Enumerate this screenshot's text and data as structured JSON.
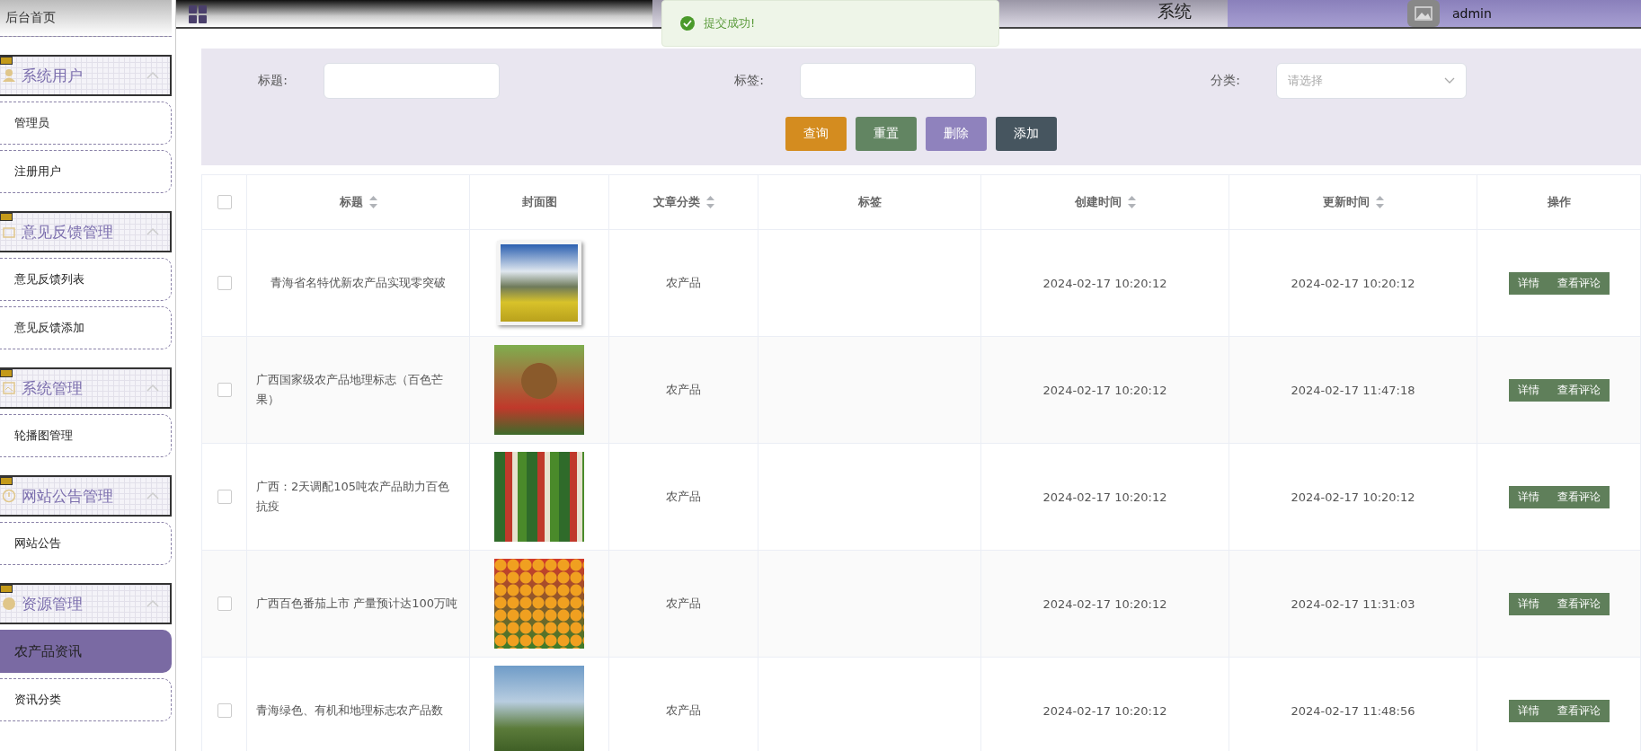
{
  "sidebar": {
    "home": {
      "label": "后台首页"
    },
    "groups": [
      {
        "label": "系统用户",
        "expanded": true,
        "items": [
          {
            "label": "管理员",
            "selected": false
          },
          {
            "label": "注册用户",
            "selected": false
          }
        ]
      },
      {
        "label": "意见反馈管理",
        "expanded": true,
        "items": [
          {
            "label": "意见反馈列表",
            "selected": false
          },
          {
            "label": "意见反馈添加",
            "selected": false
          }
        ]
      },
      {
        "label": "系统管理",
        "expanded": true,
        "items": [
          {
            "label": "轮播图管理",
            "selected": false
          }
        ]
      },
      {
        "label": "网站公告管理",
        "expanded": true,
        "items": [
          {
            "label": "网站公告",
            "selected": false
          }
        ]
      },
      {
        "label": "资源管理",
        "expanded": true,
        "items": [
          {
            "label": "农产品资讯",
            "selected": true
          },
          {
            "label": "资讯分类",
            "selected": false
          }
        ]
      }
    ]
  },
  "header": {
    "title": "系统",
    "user": "admin"
  },
  "toast": {
    "message": "提交成功!"
  },
  "search": {
    "fields": [
      {
        "kind": "text",
        "label": "标题:"
      },
      {
        "kind": "text",
        "label": "标签:"
      },
      {
        "kind": "select",
        "label": "分类:",
        "placeholder": "请选择"
      }
    ],
    "buttons": [
      {
        "label": "查询",
        "color": "#d48c1f"
      },
      {
        "label": "重置",
        "color": "#628562"
      },
      {
        "label": "删除",
        "color": "#8f82bd"
      },
      {
        "label": "添加",
        "color": "#46555f"
      }
    ]
  },
  "table": {
    "select_all": {
      "checked": false
    },
    "columns": [
      {
        "label": "标题",
        "sortable": true
      },
      {
        "label": "封面图",
        "sortable": false
      },
      {
        "label": "文章分类",
        "sortable": true
      },
      {
        "label": "标签",
        "sortable": false
      },
      {
        "label": "创建时间",
        "sortable": true
      },
      {
        "label": "更新时间",
        "sortable": true
      },
      {
        "label": "操作",
        "sortable": false
      }
    ],
    "rows": [
      {
        "checked": false,
        "title": "青海省名特优新农产品实现零突破",
        "category": "农产品",
        "created": "2024-02-17 10:20:12",
        "updated": "2024-02-17 10:20:12",
        "actions": [
          "详情",
          "查看评论"
        ]
      },
      {
        "checked": false,
        "title": "广西国家级农产品地理标志（百色芒果）",
        "category": "农产品",
        "created": "2024-02-17 10:20:12",
        "updated": "2024-02-17 11:47:18",
        "actions": [
          "详情",
          "查看评论"
        ]
      },
      {
        "checked": false,
        "title": "广西：2天调配105吨农产品助力百色抗疫",
        "category": "农产品",
        "created": "2024-02-17 10:20:12",
        "updated": "2024-02-17 10:20:12",
        "actions": [
          "详情",
          "查看评论"
        ]
      },
      {
        "checked": false,
        "title": "广西百色番茄上市 产量预计达100万吨",
        "category": "农产品",
        "created": "2024-02-17 10:20:12",
        "updated": "2024-02-17 11:31:03",
        "actions": [
          "详情",
          "查看评论"
        ]
      },
      {
        "checked": false,
        "title": "青海绿色、有机和地理标志农产品数",
        "category": "农产品",
        "created": "2024-02-17 10:20:12",
        "updated": "2024-02-17 11:48:56",
        "actions": [
          "详情",
          "查看评论"
        ]
      }
    ]
  }
}
